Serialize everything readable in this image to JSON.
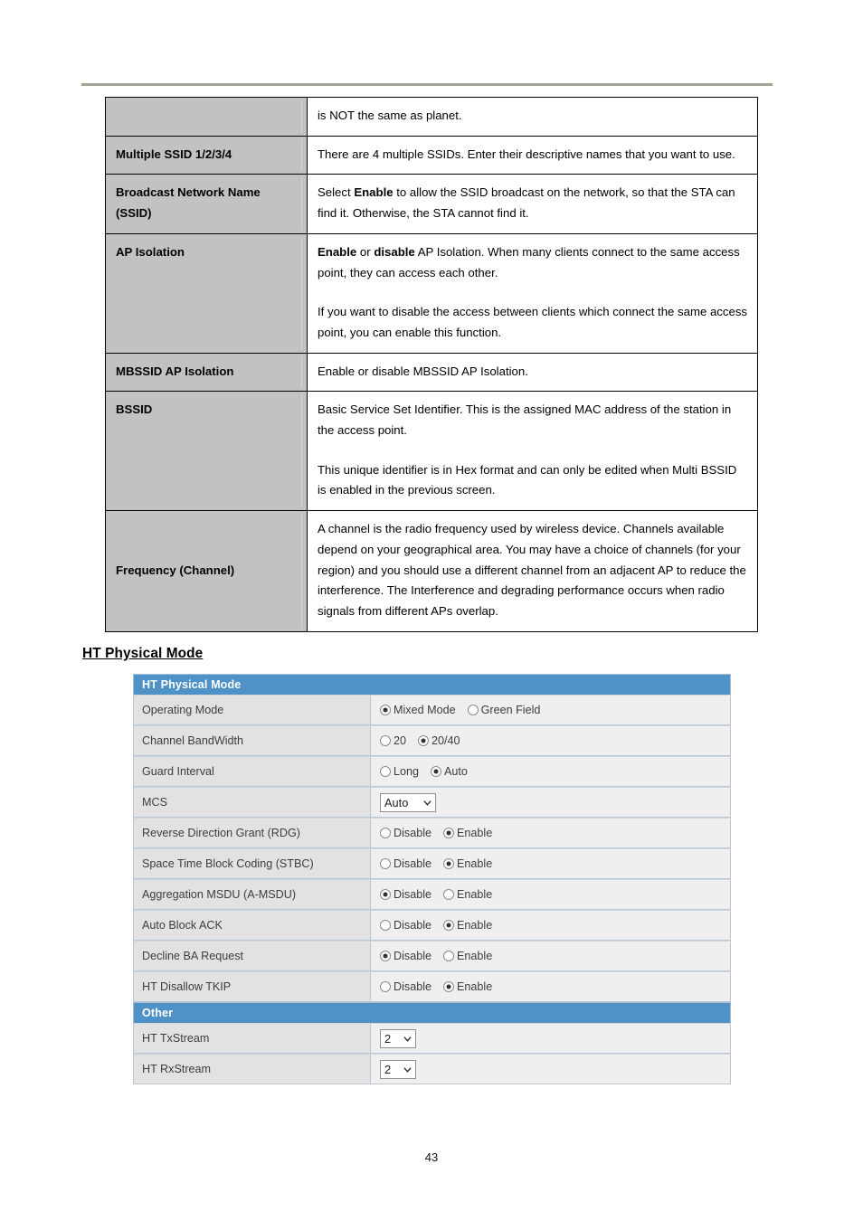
{
  "document": {
    "page_number": "43",
    "section_heading": "HT Physical Mode"
  },
  "doc_table": {
    "rows": [
      {
        "term": "",
        "paragraphs": [
          {
            "segments": [
              {
                "text": "is NOT the same as planet.",
                "bold": false
              }
            ]
          }
        ]
      },
      {
        "term": "Multiple SSID 1/2/3/4",
        "paragraphs": [
          {
            "segments": [
              {
                "text": "There are 4 multiple SSIDs. Enter their descriptive names that you want to use.",
                "bold": false
              }
            ]
          }
        ]
      },
      {
        "term": "Broadcast Network Name (SSID)",
        "paragraphs": [
          {
            "segments": [
              {
                "text": "Select ",
                "bold": false
              },
              {
                "text": "Enable",
                "bold": true
              },
              {
                "text": " to allow the SSID broadcast on the network, so that the STA can find it. Otherwise, the STA cannot find it.",
                "bold": false
              }
            ]
          }
        ]
      },
      {
        "term": "AP Isolation",
        "paragraphs": [
          {
            "segments": [
              {
                "text": "Enable",
                "bold": true
              },
              {
                "text": " or ",
                "bold": false
              },
              {
                "text": "disable",
                "bold": true
              },
              {
                "text": " AP Isolation. When many clients connect to the same access point, they can access each other.",
                "bold": false
              }
            ]
          },
          {
            "segments": [
              {
                "text": "If you want to disable the access between clients which connect the same access point, you can enable this function.",
                "bold": false
              }
            ]
          }
        ]
      },
      {
        "term": "MBSSID AP Isolation",
        "paragraphs": [
          {
            "segments": [
              {
                "text": "Enable or disable MBSSID AP Isolation.",
                "bold": false
              }
            ]
          }
        ]
      },
      {
        "term": "BSSID",
        "paragraphs": [
          {
            "segments": [
              {
                "text": "Basic Service Set Identifier. This is the assigned MAC address of the station in the access point.",
                "bold": false
              }
            ]
          },
          {
            "segments": [
              {
                "text": "This unique identifier is in Hex format and can only be edited when Multi BSSID is enabled in the previous screen.",
                "bold": false
              }
            ]
          }
        ]
      },
      {
        "term": "Frequency (Channel)",
        "term_middle": true,
        "paragraphs": [
          {
            "segments": [
              {
                "text": "A channel is the radio frequency used by wireless device. Channels available depend on your geographical area. You may have a choice of channels (for your region) and you should use a different channel from an adjacent AP to reduce the interference. The Interference and degrading performance occurs when radio signals from different APs overlap.",
                "bold": false
              }
            ]
          }
        ]
      }
    ]
  },
  "ui_panel": {
    "title_bar": "HT Physical Mode",
    "other_bar": "Other",
    "colors": {
      "bar_blue": "#4e92c8",
      "label_grey": "#e2e2e2",
      "value_grey": "#efefef",
      "border": "#b9c6d3"
    },
    "rows": [
      {
        "label": "Operating Mode",
        "control": "radio",
        "options": [
          {
            "label": "Mixed Mode",
            "selected": true
          },
          {
            "label": "Green Field",
            "selected": false
          }
        ]
      },
      {
        "label": "Channel BandWidth",
        "control": "radio",
        "options": [
          {
            "label": "20",
            "selected": false
          },
          {
            "label": "20/40",
            "selected": true
          }
        ]
      },
      {
        "label": "Guard Interval",
        "control": "radio",
        "options": [
          {
            "label": "Long",
            "selected": false
          },
          {
            "label": "Auto",
            "selected": true
          }
        ]
      },
      {
        "label": "MCS",
        "control": "select",
        "value": "Auto",
        "width": "wide"
      },
      {
        "label": "Reverse Direction Grant (RDG)",
        "control": "radio",
        "options": [
          {
            "label": "Disable",
            "selected": false
          },
          {
            "label": "Enable",
            "selected": true
          }
        ]
      },
      {
        "label": "Space Time Block Coding (STBC)",
        "control": "radio",
        "options": [
          {
            "label": "Disable",
            "selected": false
          },
          {
            "label": "Enable",
            "selected": true
          }
        ]
      },
      {
        "label": "Aggregation MSDU (A-MSDU)",
        "control": "radio",
        "options": [
          {
            "label": "Disable",
            "selected": true
          },
          {
            "label": "Enable",
            "selected": false
          }
        ]
      },
      {
        "label": "Auto Block ACK",
        "control": "radio",
        "options": [
          {
            "label": "Disable",
            "selected": false
          },
          {
            "label": "Enable",
            "selected": true
          }
        ]
      },
      {
        "label": "Decline BA Request",
        "control": "radio",
        "options": [
          {
            "label": "Disable",
            "selected": true
          },
          {
            "label": "Enable",
            "selected": false
          }
        ]
      },
      {
        "label": "HT Disallow TKIP",
        "control": "radio",
        "options": [
          {
            "label": "Disable",
            "selected": false
          },
          {
            "label": "Enable",
            "selected": true
          }
        ]
      }
    ],
    "other_rows": [
      {
        "label": "HT TxStream",
        "control": "select",
        "value": "2",
        "width": "narrow"
      },
      {
        "label": "HT RxStream",
        "control": "select",
        "value": "2",
        "width": "narrow"
      }
    ]
  }
}
